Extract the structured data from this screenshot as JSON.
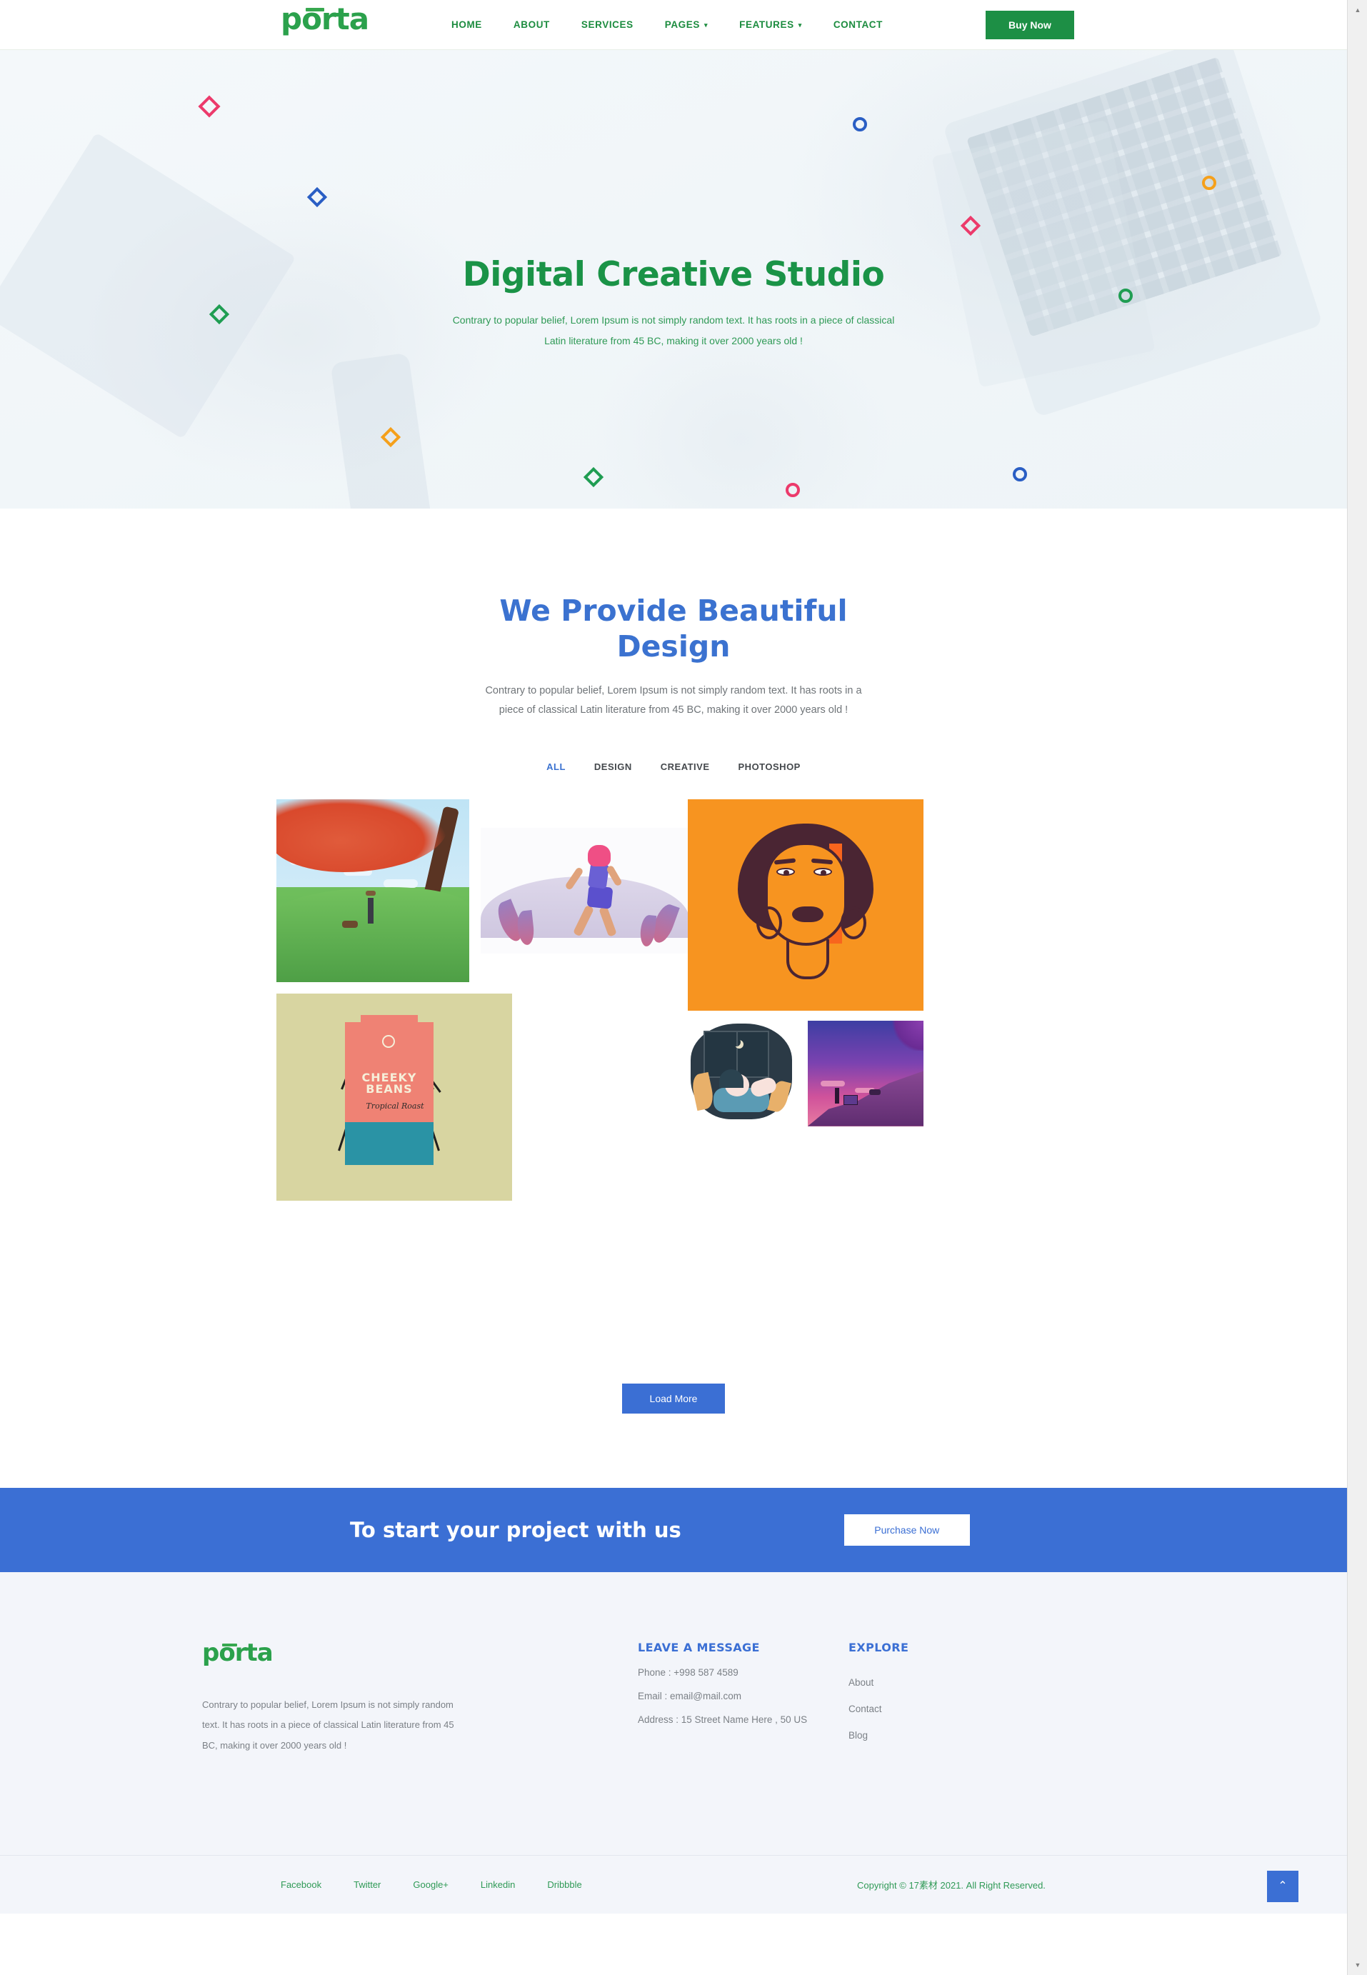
{
  "header": {
    "logo_text": "porta",
    "nav": [
      {
        "label": "HOME",
        "has_caret": false
      },
      {
        "label": "ABOUT",
        "has_caret": false
      },
      {
        "label": "SERVICES",
        "has_caret": false
      },
      {
        "label": "PAGES",
        "has_caret": true
      },
      {
        "label": "FEATURES",
        "has_caret": true
      },
      {
        "label": "CONTACT",
        "has_caret": false
      }
    ],
    "buy_now_label": "Buy Now"
  },
  "hero": {
    "title": "Digital Creative Studio",
    "line1": "Contrary to popular belief, Lorem Ipsum is not simply random text. It has roots in a piece of classical",
    "line2": "Latin literature from 45 BC, making it over 2000 years old !"
  },
  "portfolio": {
    "title_line1": "We Provide Beautiful",
    "title_line2": "Design",
    "sub_line1": "Contrary to popular belief, Lorem Ipsum is not simply random text. It has roots in a",
    "sub_line2": "piece of classical Latin literature from 45 BC, making it over 2000 years old !",
    "filters": [
      {
        "label": "ALL",
        "active": true
      },
      {
        "label": "DESIGN",
        "active": false
      },
      {
        "label": "CREATIVE",
        "active": false
      },
      {
        "label": "PHOTOSHOP",
        "active": false
      }
    ],
    "items": [
      {
        "name": "autumn-tree-illustration",
        "caption": ""
      },
      {
        "name": "runner-illustration",
        "caption": ""
      },
      {
        "name": "woman-portrait-illustration",
        "caption": ""
      },
      {
        "name": "cheeky-beans-packaging",
        "brand": "CHEEKY BEANS",
        "variant": "Tropical Roast"
      },
      {
        "name": "sleeping-woman-illustration",
        "caption": ""
      },
      {
        "name": "dusk-painter-illustration",
        "caption": ""
      }
    ],
    "load_more_label": "Load More"
  },
  "cta": {
    "heading": "To start your project with us",
    "button_label": "Purchase Now"
  },
  "footer": {
    "logo_text": "porta",
    "about": "Contrary to popular belief, Lorem Ipsum is not simply random text. It has roots in a piece of classical Latin literature from 45 BC, making it over 2000 years old !",
    "message": {
      "heading": "LEAVE A MESSAGE",
      "phone": "Phone : +998 587 4589",
      "email": "Email : email@mail.com",
      "address": "Address : 15 Street Name Here , 50 US"
    },
    "explore": {
      "heading": "EXPLORE",
      "links": [
        "About",
        "Contact",
        "Blog"
      ]
    },
    "social": [
      "Facebook",
      "Twitter",
      "Google+",
      "Linkedin",
      "Dribbble"
    ],
    "copyright": "Copyright © 17素材 2021. All Right Reserved.",
    "to_top_glyph": "⌃"
  },
  "colors": {
    "brand_green": "#1d8f45",
    "accent_blue": "#3b6fd4",
    "hero_text_green": "#1a9347",
    "muted": "#7b8086",
    "shape_pink": "#ec3a6b",
    "shape_blue": "#2a5ec4",
    "shape_green": "#1f9d52",
    "shape_orange": "#f5a01b"
  }
}
